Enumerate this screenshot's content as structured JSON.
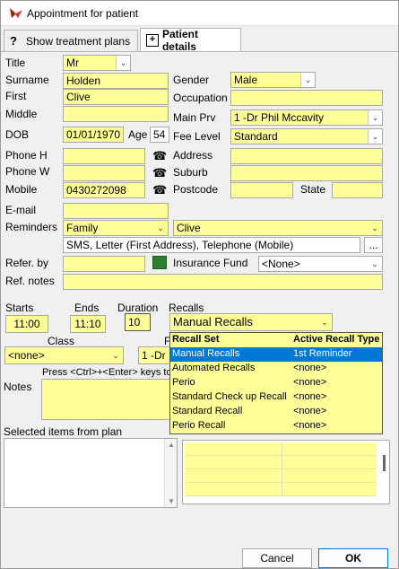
{
  "window": {
    "title": "Appointment for patient",
    "tabs": [
      {
        "label": "Show treatment plans",
        "icon": "question-icon"
      },
      {
        "label": "Patient details",
        "icon": "add-page-icon"
      }
    ]
  },
  "patient": {
    "title_label": "Title",
    "title_value": "Mr",
    "surname_label": "Surname",
    "surname_value": "Holden",
    "first_label": "First",
    "first_value": "Clive",
    "middle_label": "Middle",
    "middle_value": "",
    "dob_label": "DOB",
    "dob_value": "01/01/1970",
    "age_label": "Age",
    "age_value": "54",
    "gender_label": "Gender",
    "gender_value": "Male",
    "occupation_label": "Occupation",
    "occupation_value": "",
    "main_prv_label": "Main Prv",
    "main_prv_value": "1 -Dr Phil Mccavity",
    "fee_level_label": "Fee Level",
    "fee_level_value": "Standard",
    "phone_h_label": "Phone H",
    "phone_h_value": "",
    "phone_w_label": "Phone W",
    "phone_w_value": "",
    "mobile_label": "Mobile",
    "mobile_value": "0430272098",
    "address_label": "Address",
    "address_value": "",
    "suburb_label": "Suburb",
    "suburb_value": "",
    "postcode_label": "Postcode",
    "postcode_value": "",
    "state_label": "State",
    "state_value": "",
    "email_label": "E-mail",
    "email_value": "",
    "reminders_label": "Reminders",
    "reminders_type": "Family",
    "reminders_person": "Clive",
    "reminders_methods": "SMS, Letter (First Address), Telephone (Mobile)",
    "reminders_more": "...",
    "refer_by_label": "Refer. by",
    "refer_by_value": "",
    "insurance_label": "Insurance Fund",
    "insurance_value": "<None>",
    "ref_notes_label": "Ref. notes",
    "ref_notes_value": ""
  },
  "appointment": {
    "starts_label": "Starts",
    "starts_value": "11:00",
    "ends_label": "Ends",
    "ends_value": "11:10",
    "duration_label": "Duration",
    "duration_value": "10",
    "recalls_label": "Recalls",
    "recalls_value": "Manual Recalls",
    "class_label": "Class",
    "class_value": "<none>",
    "provider_label_partial": "F",
    "provider_value_partial": "1 -Dr",
    "notes_label": "Notes",
    "notes_hint": "Press <Ctrl>+<Enter> keys to",
    "selected_items_label": "Selected items from plan"
  },
  "recall_dropdown": {
    "headers": [
      "Recall Set",
      "Active Recall Type"
    ],
    "rows": [
      {
        "set": "Manual Recalls",
        "type": "1st Reminder",
        "selected": true
      },
      {
        "set": "Automated Recalls",
        "type": "<none>",
        "selected": false
      },
      {
        "set": "Perio",
        "type": "<none>",
        "selected": false
      },
      {
        "set": "Standard Check up Recall",
        "type": "<none>",
        "selected": false
      },
      {
        "set": "Standard Recall",
        "type": "<none>",
        "selected": false
      },
      {
        "set": "Perio Recall",
        "type": "<none>",
        "selected": false
      }
    ]
  },
  "buttons": {
    "cancel": "Cancel",
    "ok": "OK"
  },
  "colors": {
    "field_yellow": "#ffff99",
    "selection_blue": "#0078d7",
    "app_icon_red": "#d83b2b"
  }
}
